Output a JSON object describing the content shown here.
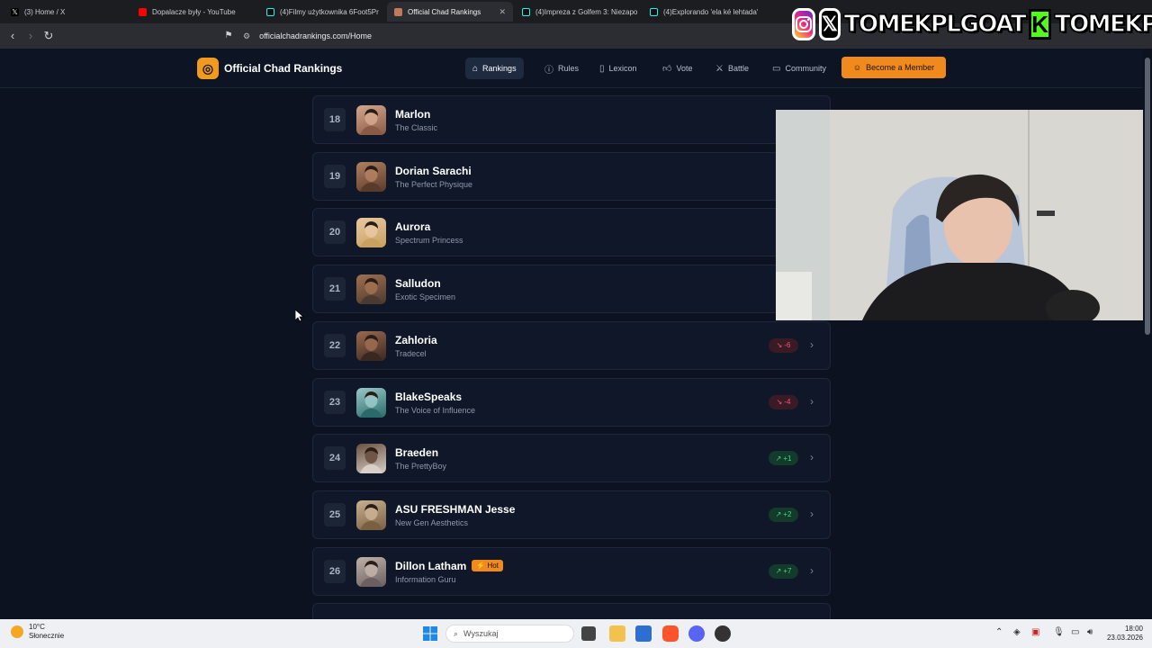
{
  "browser": {
    "tabs": [
      {
        "label": "(3) Home / X",
        "active": false,
        "favicon_color": "#000000"
      },
      {
        "label": "Dopalacze były - YouTube",
        "active": false,
        "favicon_color": "#ff0000"
      },
      {
        "label": "(4)Filmy użytkownika 6Foot5Pr",
        "active": false,
        "favicon_color": "#25f4ee"
      },
      {
        "label": "Official Chad Rankings",
        "active": true,
        "favicon_color": "#c07a5a"
      },
      {
        "label": "(4)Impreza z Golfem 3: Niezapo",
        "active": false,
        "favicon_color": "#25f4ee"
      },
      {
        "label": "(4)Explorando 'ela ké lehtada'",
        "active": false,
        "favicon_color": "#25f4ee"
      }
    ],
    "url": "officialchadrankings.com/Home"
  },
  "overlay": {
    "handle_1": "TOMEKPLGOAT",
    "kick_letter": "K",
    "handle_2": "TOMEKPL"
  },
  "site": {
    "brand": "Official Chad Rankings",
    "nav": [
      {
        "label": "Rankings",
        "icon": "home-icon",
        "active": true
      },
      {
        "label": "Rules",
        "icon": "info-icon",
        "active": false
      },
      {
        "label": "Lexicon",
        "icon": "book-icon",
        "active": false
      },
      {
        "label": "Vote",
        "icon": "thumbs-up-icon",
        "active": false
      },
      {
        "label": "Battle",
        "icon": "swords-icon",
        "active": false
      },
      {
        "label": "Community",
        "icon": "chat-icon",
        "active": false
      }
    ],
    "cta": "Become a Member"
  },
  "rankings": [
    {
      "rank": "18",
      "name": "Marlon",
      "title": "The Classic",
      "badge": "",
      "change": "",
      "dir": "down"
    },
    {
      "rank": "19",
      "name": "Dorian Sarachi",
      "title": "The Perfect Physique",
      "badge": "",
      "change": "",
      "dir": "down"
    },
    {
      "rank": "20",
      "name": "Aurora",
      "title": "Spectrum Princess",
      "badge": "",
      "change": "",
      "dir": "none"
    },
    {
      "rank": "21",
      "name": "Salludon",
      "title": "Exotic Specimen",
      "badge": "",
      "change": "",
      "dir": "down"
    },
    {
      "rank": "22",
      "name": "Zahloria",
      "title": "Tradecel",
      "badge": "",
      "change": "-6",
      "dir": "down"
    },
    {
      "rank": "23",
      "name": "BlakeSpeaks",
      "title": "The Voice of Influence",
      "badge": "",
      "change": "-4",
      "dir": "down"
    },
    {
      "rank": "24",
      "name": "Braeden",
      "title": "The PrettyBoy",
      "badge": "",
      "change": "+1",
      "dir": "up"
    },
    {
      "rank": "25",
      "name": "ASU FRESHMAN Jesse",
      "title": "New Gen Aesthetics",
      "badge": "",
      "change": "+2",
      "dir": "up"
    },
    {
      "rank": "26",
      "name": "Dillon Latham",
      "title": "Information Guru",
      "badge": "Hot",
      "change": "+7",
      "dir": "up"
    }
  ],
  "taskbar": {
    "weather_temp": "10°C",
    "weather_desc": "Słonecznie",
    "search_placeholder": "Wyszukaj",
    "time": "18:00",
    "date": "23.03.2026"
  },
  "colors": {
    "accent": "#f08a1c",
    "up": "#3ddc84",
    "down": "#ef5b6e",
    "page_bg": "#0c1220"
  }
}
